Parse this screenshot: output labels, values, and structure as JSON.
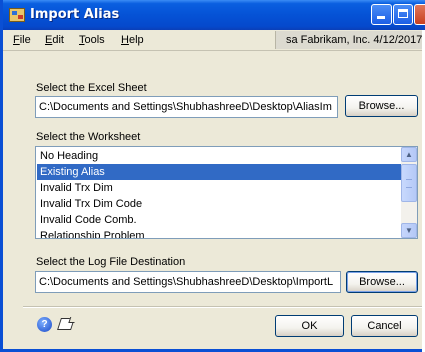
{
  "window": {
    "title": "Import Alias"
  },
  "menu": {
    "items": [
      {
        "mnemonic": "F",
        "rest": "ile"
      },
      {
        "mnemonic": "E",
        "rest": "dit"
      },
      {
        "mnemonic": "T",
        "rest": "ools"
      },
      {
        "mnemonic": "H",
        "rest": "elp"
      }
    ],
    "company_info": "sa  Fabrikam, Inc.  4/12/2017"
  },
  "excel_sheet": {
    "label": "Select the Excel Sheet",
    "value": "C:\\Documents and Settings\\ShubhashreeD\\Desktop\\AliasIm",
    "browse_label": "Browse..."
  },
  "worksheet": {
    "label": "Select the Worksheet",
    "items": [
      "No Heading",
      "Existing Alias",
      "Invalid Trx Dim",
      "Invalid Trx Dim Code",
      "Invalid Code Comb.",
      "Relationship Problem"
    ],
    "selected": "Existing Alias"
  },
  "log_file": {
    "label": "Select the Log File Destination",
    "value": "C:\\Documents and Settings\\ShubhashreeD\\Desktop\\ImportL",
    "browse_label": "Browse..."
  },
  "footer": {
    "ok_label": "OK",
    "cancel_label": "Cancel"
  },
  "colors": {
    "titlebar": "#0552d6",
    "selection": "#316ac5",
    "dialog": "#ece9d8"
  }
}
